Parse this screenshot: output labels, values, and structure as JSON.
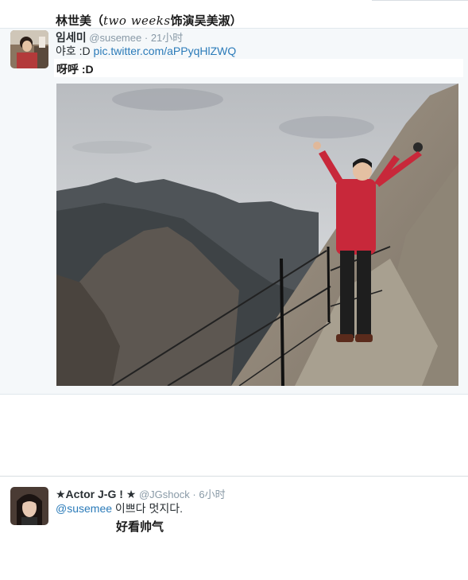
{
  "caption_title": {
    "name": "林世美",
    "open_paren": "（",
    "script_text": "two weeks",
    "rest": "饰演吴美淑）"
  },
  "tweet1": {
    "name": "임세미",
    "handle": "@susemee",
    "separator": "·",
    "time": "21小时",
    "text_prefix": "야호 :D ",
    "link_text": "pic.twitter.com/aPPyqHlZWQ",
    "translation": "呀呼 :D",
    "photo_alt": "hiker-on-mountain-ridge"
  },
  "tweet2": {
    "name": "★Actor J-G ! ★",
    "handle": "@JGshock",
    "separator": "·",
    "time": "6小时",
    "mention": "@susemee",
    "text": " 이쁘다 멋지다.",
    "translation": "好看帅气"
  },
  "colors": {
    "link": "#2b7bb9",
    "muted": "#8899a6",
    "tweet_bg": "#f5f8fa"
  }
}
